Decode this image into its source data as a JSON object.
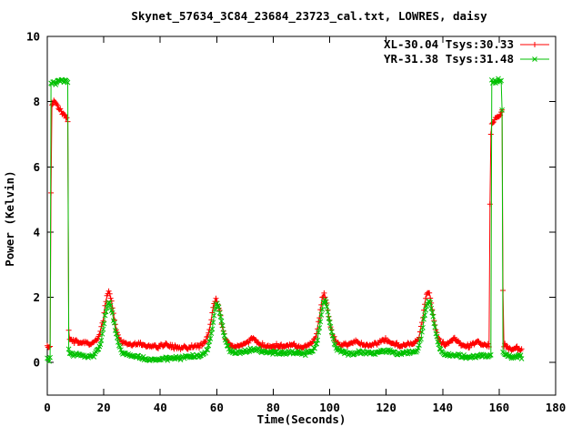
{
  "window": {
    "kind": "gnuplot-chart-screenshot"
  },
  "chart_data": {
    "type": "line",
    "title": "Skynet_57634_3C84_23684_23723_cal.txt, LOWRES, daisy",
    "xlabel": "Time(Seconds)",
    "ylabel": "Power (Kelvin)",
    "xlim": [
      0,
      180
    ],
    "ylim": [
      -1,
      10
    ],
    "xticks": [
      0,
      20,
      40,
      60,
      80,
      100,
      120,
      140,
      160,
      180
    ],
    "yticks": [
      0,
      2,
      4,
      6,
      8,
      10
    ],
    "grid": false,
    "legend_position": "inside-top-right",
    "background": "#ffffff",
    "border_color": "#000000",
    "text_color": "#000000",
    "sample_step_s": 0.33,
    "description": "Radio telescope calibration scan: cal-on plateaus at start (~t=1-7.5s) and end (~t=157-161s), four daisy-scan source peaks near t=22, 60, 98, 135 s over a low baseline.",
    "series": [
      {
        "name": "XL-30.04 Tsys:30.33",
        "color": "#ff0000",
        "marker": "plus",
        "style": "linespoints",
        "scatter": 0.05,
        "keypoints": [
          [
            0,
            0.5
          ],
          [
            0.7,
            0.45
          ],
          [
            1.2,
            0.55
          ],
          [
            1.32,
            5.2
          ],
          [
            1.45,
            7.85
          ],
          [
            2.2,
            7.95
          ],
          [
            3,
            8
          ],
          [
            4,
            7.85
          ],
          [
            5,
            7.7
          ],
          [
            6,
            7.6
          ],
          [
            7,
            7.5
          ],
          [
            7.3,
            7.45
          ],
          [
            7.45,
            4.8
          ],
          [
            7.6,
            0.72
          ],
          [
            9,
            0.66
          ],
          [
            11,
            0.62
          ],
          [
            13,
            0.6
          ],
          [
            15,
            0.58
          ],
          [
            16.5,
            0.62
          ],
          [
            18,
            0.78
          ],
          [
            19,
            1
          ],
          [
            19.8,
            1.35
          ],
          [
            20.6,
            1.8
          ],
          [
            21.2,
            2.05
          ],
          [
            21.7,
            2.18
          ],
          [
            22.3,
            2.05
          ],
          [
            23,
            1.75
          ],
          [
            23.8,
            1.3
          ],
          [
            24.6,
            0.95
          ],
          [
            25.5,
            0.72
          ],
          [
            26.5,
            0.62
          ],
          [
            28,
            0.58
          ],
          [
            30,
            0.55
          ],
          [
            32,
            0.6
          ],
          [
            34,
            0.52
          ],
          [
            36,
            0.5
          ],
          [
            38,
            0.48
          ],
          [
            40,
            0.5
          ],
          [
            42,
            0.55
          ],
          [
            44,
            0.5
          ],
          [
            46,
            0.45
          ],
          [
            48,
            0.47
          ],
          [
            50,
            0.45
          ],
          [
            52,
            0.5
          ],
          [
            54,
            0.52
          ],
          [
            55.5,
            0.6
          ],
          [
            56.5,
            0.75
          ],
          [
            57.5,
            1.05
          ],
          [
            58.5,
            1.55
          ],
          [
            59.3,
            1.9
          ],
          [
            59.8,
            1.97
          ],
          [
            60.4,
            1.85
          ],
          [
            61.2,
            1.5
          ],
          [
            62,
            1.1
          ],
          [
            63,
            0.8
          ],
          [
            64,
            0.62
          ],
          [
            65.5,
            0.5
          ],
          [
            67,
            0.48
          ],
          [
            69,
            0.55
          ],
          [
            71,
            0.62
          ],
          [
            72.5,
            0.72
          ],
          [
            74,
            0.65
          ],
          [
            75.5,
            0.55
          ],
          [
            77,
            0.5
          ],
          [
            79,
            0.48
          ],
          [
            81,
            0.52
          ],
          [
            83,
            0.5
          ],
          [
            85,
            0.52
          ],
          [
            87,
            0.55
          ],
          [
            89,
            0.48
          ],
          [
            91,
            0.5
          ],
          [
            93,
            0.55
          ],
          [
            94.5,
            0.68
          ],
          [
            95.5,
            0.95
          ],
          [
            96.5,
            1.5
          ],
          [
            97.3,
            1.95
          ],
          [
            97.9,
            2.15
          ],
          [
            98.5,
            2
          ],
          [
            99.3,
            1.6
          ],
          [
            100.2,
            1.15
          ],
          [
            101,
            0.85
          ],
          [
            102,
            0.65
          ],
          [
            103.5,
            0.55
          ],
          [
            105,
            0.52
          ],
          [
            107,
            0.58
          ],
          [
            109,
            0.65
          ],
          [
            110.5,
            0.6
          ],
          [
            112,
            0.55
          ],
          [
            114,
            0.5
          ],
          [
            116,
            0.55
          ],
          [
            118,
            0.68
          ],
          [
            120,
            0.7
          ],
          [
            121.5,
            0.62
          ],
          [
            123,
            0.55
          ],
          [
            125,
            0.5
          ],
          [
            127,
            0.52
          ],
          [
            129,
            0.55
          ],
          [
            130.5,
            0.6
          ],
          [
            131.5,
            0.75
          ],
          [
            132.5,
            1.1
          ],
          [
            133.5,
            1.7
          ],
          [
            134.3,
            2.1
          ],
          [
            134.9,
            2.2
          ],
          [
            135.5,
            2.08
          ],
          [
            136.3,
            1.65
          ],
          [
            137.2,
            1.15
          ],
          [
            138.2,
            0.8
          ],
          [
            139.2,
            0.6
          ],
          [
            141,
            0.55
          ],
          [
            143,
            0.65
          ],
          [
            144.2,
            0.73
          ],
          [
            145.5,
            0.62
          ],
          [
            147,
            0.52
          ],
          [
            149,
            0.5
          ],
          [
            151,
            0.58
          ],
          [
            152.5,
            0.63
          ],
          [
            154,
            0.55
          ],
          [
            155.5,
            0.5
          ],
          [
            156.6,
            0.52
          ],
          [
            156.8,
            6.3
          ],
          [
            157.2,
            7.3
          ],
          [
            158,
            7.42
          ],
          [
            159,
            7.52
          ],
          [
            160,
            7.62
          ],
          [
            160.8,
            7.72
          ],
          [
            161.1,
            7.78
          ],
          [
            161.25,
            4.7
          ],
          [
            161.45,
            0.55
          ],
          [
            162.5,
            0.48
          ],
          [
            164,
            0.42
          ],
          [
            165.5,
            0.45
          ],
          [
            167,
            0.4
          ],
          [
            168,
            0.38
          ]
        ]
      },
      {
        "name": "YR-31.38 Tsys:31.48",
        "color": "#00c000",
        "marker": "cross",
        "style": "linespoints",
        "scatter": 0.045,
        "keypoints": [
          [
            0,
            0.1
          ],
          [
            0.5,
            0.06
          ],
          [
            1,
            0.12
          ],
          [
            1.1,
            1.7
          ],
          [
            1.25,
            8.55
          ],
          [
            2,
            8.62
          ],
          [
            2.8,
            8.55
          ],
          [
            3.6,
            8.65
          ],
          [
            4.4,
            8.6
          ],
          [
            5.2,
            8.68
          ],
          [
            6,
            8.6
          ],
          [
            6.8,
            8.62
          ],
          [
            7.3,
            8.58
          ],
          [
            7.45,
            2
          ],
          [
            7.6,
            0.3
          ],
          [
            9,
            0.25
          ],
          [
            11,
            0.22
          ],
          [
            13,
            0.2
          ],
          [
            15,
            0.2
          ],
          [
            16.5,
            0.24
          ],
          [
            18,
            0.38
          ],
          [
            19,
            0.62
          ],
          [
            19.8,
            1
          ],
          [
            20.6,
            1.5
          ],
          [
            21.3,
            1.78
          ],
          [
            21.9,
            1.88
          ],
          [
            22.5,
            1.75
          ],
          [
            23.2,
            1.45
          ],
          [
            24,
            1.05
          ],
          [
            24.8,
            0.7
          ],
          [
            25.7,
            0.45
          ],
          [
            26.7,
            0.3
          ],
          [
            28,
            0.25
          ],
          [
            30,
            0.2
          ],
          [
            32,
            0.16
          ],
          [
            34,
            0.12
          ],
          [
            36,
            0.1
          ],
          [
            38,
            0.1
          ],
          [
            40,
            0.09
          ],
          [
            42,
            0.1
          ],
          [
            44,
            0.12
          ],
          [
            46,
            0.14
          ],
          [
            48,
            0.16
          ],
          [
            50,
            0.17
          ],
          [
            52,
            0.18
          ],
          [
            54,
            0.2
          ],
          [
            55.5,
            0.28
          ],
          [
            56.7,
            0.42
          ],
          [
            57.7,
            0.7
          ],
          [
            58.7,
            1.2
          ],
          [
            59.5,
            1.68
          ],
          [
            60.1,
            1.82
          ],
          [
            60.7,
            1.7
          ],
          [
            61.5,
            1.35
          ],
          [
            62.3,
            0.95
          ],
          [
            63.3,
            0.6
          ],
          [
            64.3,
            0.42
          ],
          [
            65.5,
            0.32
          ],
          [
            67,
            0.3
          ],
          [
            69,
            0.33
          ],
          [
            71,
            0.36
          ],
          [
            72.5,
            0.4
          ],
          [
            74,
            0.4
          ],
          [
            75.5,
            0.36
          ],
          [
            77,
            0.33
          ],
          [
            79,
            0.3
          ],
          [
            81,
            0.32
          ],
          [
            83,
            0.3
          ],
          [
            85,
            0.3
          ],
          [
            87,
            0.32
          ],
          [
            89,
            0.28
          ],
          [
            91,
            0.28
          ],
          [
            93,
            0.32
          ],
          [
            94.8,
            0.45
          ],
          [
            95.8,
            0.75
          ],
          [
            96.8,
            1.3
          ],
          [
            97.6,
            1.75
          ],
          [
            98.2,
            1.92
          ],
          [
            98.8,
            1.8
          ],
          [
            99.6,
            1.45
          ],
          [
            100.5,
            1
          ],
          [
            101.4,
            0.65
          ],
          [
            102.4,
            0.45
          ],
          [
            103.5,
            0.35
          ],
          [
            105,
            0.3
          ],
          [
            107,
            0.28
          ],
          [
            109,
            0.3
          ],
          [
            111,
            0.32
          ],
          [
            113,
            0.3
          ],
          [
            115,
            0.28
          ],
          [
            117,
            0.3
          ],
          [
            119,
            0.34
          ],
          [
            121,
            0.35
          ],
          [
            123,
            0.3
          ],
          [
            125,
            0.28
          ],
          [
            127,
            0.3
          ],
          [
            129,
            0.3
          ],
          [
            130.8,
            0.35
          ],
          [
            131.8,
            0.55
          ],
          [
            132.8,
            0.95
          ],
          [
            133.8,
            1.55
          ],
          [
            134.6,
            1.85
          ],
          [
            135.2,
            1.9
          ],
          [
            135.8,
            1.78
          ],
          [
            136.6,
            1.4
          ],
          [
            137.5,
            0.95
          ],
          [
            138.5,
            0.55
          ],
          [
            139.5,
            0.35
          ],
          [
            141,
            0.25
          ],
          [
            143,
            0.22
          ],
          [
            145,
            0.2
          ],
          [
            147,
            0.18
          ],
          [
            149,
            0.17
          ],
          [
            151,
            0.2
          ],
          [
            153,
            0.22
          ],
          [
            155,
            0.2
          ],
          [
            156.5,
            0.18
          ],
          [
            157.1,
            0.2
          ],
          [
            157.25,
            8.6
          ],
          [
            158,
            8.66
          ],
          [
            158.8,
            8.6
          ],
          [
            159.6,
            8.7
          ],
          [
            160.4,
            8.62
          ],
          [
            161,
            8.65
          ],
          [
            161.15,
            5.25
          ],
          [
            161.35,
            0.3
          ],
          [
            162.5,
            0.22
          ],
          [
            164,
            0.18
          ],
          [
            165.5,
            0.2
          ],
          [
            167,
            0.18
          ],
          [
            168,
            0.17
          ]
        ]
      }
    ]
  }
}
